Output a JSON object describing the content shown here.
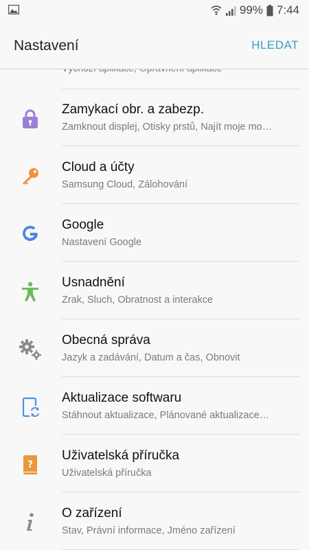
{
  "status_bar": {
    "battery": "99%",
    "time": "7:44"
  },
  "app_bar": {
    "title": "Nastavení",
    "search": "HLEDAT"
  },
  "partial_item": {
    "subtitle": "Výchozí aplikace, Oprávnění aplikace"
  },
  "items": [
    {
      "title": "Zamykací obr. a zabezp.",
      "subtitle": "Zamknout displej, Otisky prstů, Najít moje mo…",
      "icon": "lock-icon",
      "color": "#9b7fd6"
    },
    {
      "title": "Cloud a účty",
      "subtitle": "Samsung Cloud, Zálohování",
      "icon": "key-icon",
      "color": "#f0913a"
    },
    {
      "title": "Google",
      "subtitle": "Nastavení Google",
      "icon": "google-icon",
      "color": "#4a84e6"
    },
    {
      "title": "Usnadnění",
      "subtitle": "Zrak, Sluch, Obratnost a interakce",
      "icon": "accessibility-icon",
      "color": "#6dbb5e"
    },
    {
      "title": "Obecná správa",
      "subtitle": "Jazyk a zadávání, Datum a čas, Obnovit",
      "icon": "gears-icon",
      "color": "#8a8a8a"
    },
    {
      "title": "Aktualizace softwaru",
      "subtitle": "Stáhnout aktualizace, Plánované aktualizace…",
      "icon": "software-update-icon",
      "color": "#4a93e0"
    },
    {
      "title": "Uživatelská příručka",
      "subtitle": "Uživatelská příručka",
      "icon": "user-manual-icon",
      "color": "#e89a3a"
    },
    {
      "title": "O zařízení",
      "subtitle": "Stav, Právní informace, Jméno zařízení",
      "icon": "info-icon",
      "color": "#8a8a8a"
    }
  ]
}
